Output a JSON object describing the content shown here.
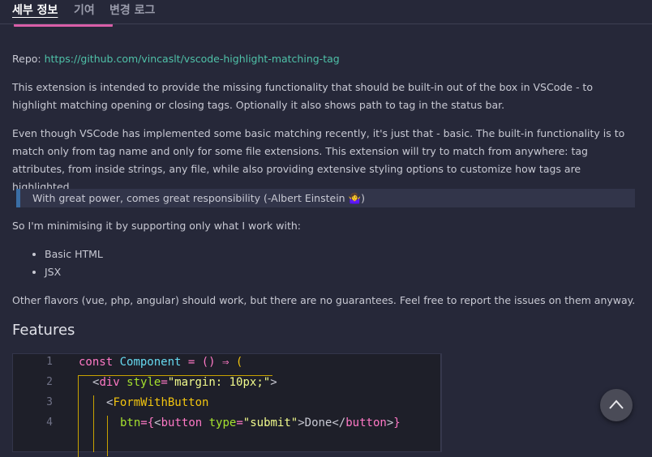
{
  "tabs": [
    "세부 정보",
    "기여",
    "변경 로그"
  ],
  "repo": {
    "label": "Repo: ",
    "url": "https://github.com/vincaslt/vscode-highlight-matching-tag"
  },
  "p1": "This extension is intended to provide the missing functionality that should be built-in out of the box in VSCode - to highlight matching opening or closing tags. Optionally it also shows path to tag in the status bar.",
  "p2": "Even though VSCode has implemented some basic matching recently, it's just that - basic. The built-in functionality is to match only from tag name and only for some file extensions. This extension will try to match from anywhere: tag attributes, from inside strings, any file, while also providing extensive styling options to customize how tags are highlighted.",
  "quote": "With great power, comes great responsibility (-Albert Einstein 🤷‍♀️)",
  "p3": "So I'm minimising it by supporting only what I work with:",
  "list": [
    "Basic HTML",
    "JSX"
  ],
  "p4": "Other flavors (vue, php, angular) should work, but there are no guarantees. Feel free to report the issues on them anyway.",
  "features_heading": "Features",
  "code": {
    "line_numbers": [
      "1",
      "2",
      "3",
      "4"
    ],
    "line1": [
      "const",
      " Component",
      " = () ",
      "⇒",
      " ("
    ],
    "line2": [
      "<",
      "div",
      " style",
      "=",
      "\"margin: 10px;\"",
      ">"
    ],
    "line3": [
      "<",
      "FormWithButton"
    ],
    "line4": [
      "btn",
      "=",
      "{",
      "<",
      "button",
      " type",
      "=",
      "\"submit\"",
      ">Done</",
      "button",
      ">",
      "}"
    ]
  },
  "scroll_top_icon": "chevron-up-icon"
}
